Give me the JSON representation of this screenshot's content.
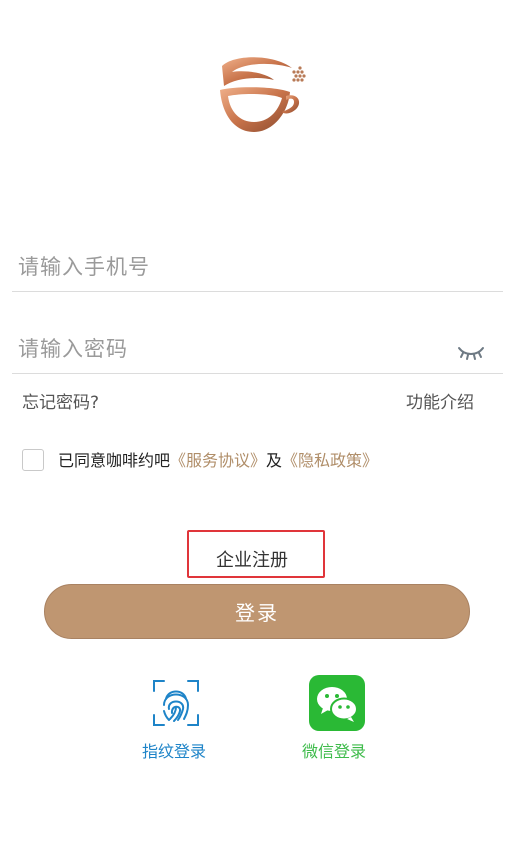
{
  "login": {
    "phone_placeholder": "请输入手机号",
    "password_placeholder": "请输入密码",
    "forgot_password": "忘记密码?",
    "feature_intro": "功能介绍",
    "agreement_prefix": "已同意咖啡约吧",
    "service_agreement": "《服务协议》",
    "and_text": "及",
    "privacy_policy": "《隐私政策》",
    "enterprise_register": "企业注册",
    "login_button": "登录"
  },
  "quick_login": {
    "fingerprint_label": "指纹登录",
    "wechat_label": "微信登录"
  },
  "colors": {
    "accent": "#bf9671",
    "link_gold": "#b08e69",
    "highlight_red": "#e0353a",
    "fingerprint_blue": "#1e84c8",
    "wechat_green": "#2ab935"
  },
  "icons": [
    "coffee-cup-logo-icon",
    "eye-closed-icon",
    "fingerprint-icon",
    "wechat-icon"
  ]
}
